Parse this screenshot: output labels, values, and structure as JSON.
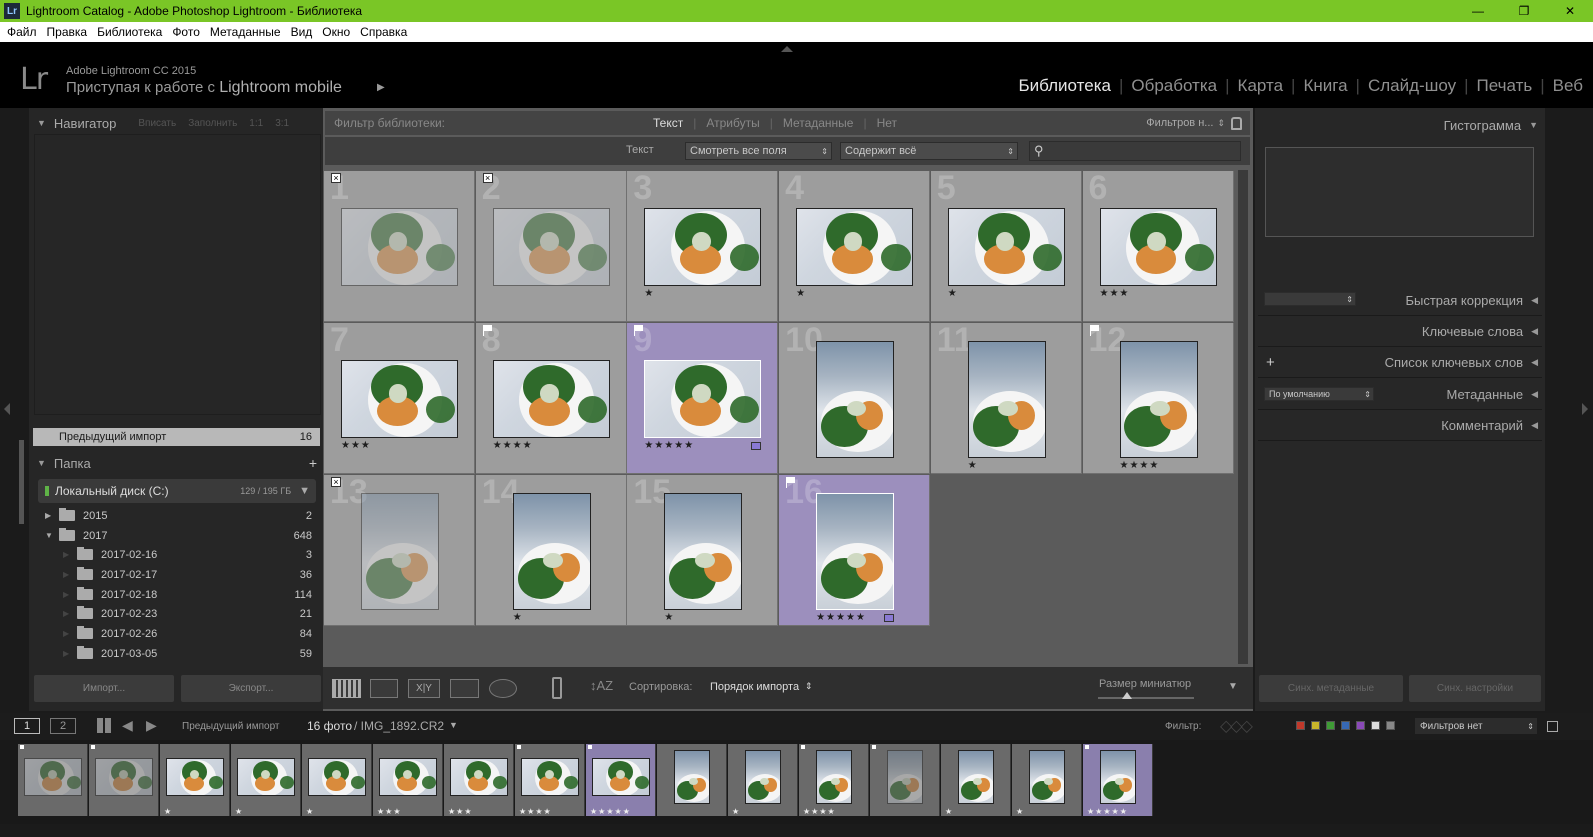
{
  "window": {
    "app_icon": "Lr",
    "title": "Lightroom Catalog - Adobe Photoshop Lightroom - Библиотека",
    "minimize": "—",
    "maximize": "❐",
    "close": "✕"
  },
  "menu": [
    "Файл",
    "Правка",
    "Библиотека",
    "Фото",
    "Метаданные",
    "Вид",
    "Окно",
    "Справка"
  ],
  "identity": {
    "logo": "Lr",
    "product": "Adobe Lightroom CC 2015",
    "mobile_prefix": "Приступая к работе с ",
    "mobile_bold": "Lightroom mobile",
    "play": "▶"
  },
  "modules": [
    "Библиотека",
    "Обработка",
    "Карта",
    "Книга",
    "Слайд-шоу",
    "Печать",
    "Веб"
  ],
  "active_module": "Библиотека",
  "navigator": {
    "title": "Навигатор",
    "zoom_options": [
      "Вписать",
      "Заполнить",
      "1:1",
      "3:1"
    ]
  },
  "catalog": {
    "label": "Предыдущий импорт",
    "count": "16"
  },
  "folders": {
    "title": "Папка",
    "add": "+",
    "disk_label": "Локальный диск (C:)",
    "disk_usage": "129 / 195 ГБ",
    "items": [
      {
        "name": "2015",
        "count": "2",
        "expand": "▶"
      },
      {
        "name": "2017",
        "count": "648",
        "expand": "▼"
      },
      {
        "name": "2017-02-16",
        "count": "3",
        "expand": "▶"
      },
      {
        "name": "2017-02-17",
        "count": "36",
        "expand": "▶"
      },
      {
        "name": "2017-02-18",
        "count": "114",
        "expand": "▶"
      },
      {
        "name": "2017-02-23",
        "count": "21",
        "expand": "▶"
      },
      {
        "name": "2017-02-26",
        "count": "84",
        "expand": "▶"
      },
      {
        "name": "2017-03-05",
        "count": "59",
        "expand": "▶"
      }
    ]
  },
  "left_buttons": {
    "import": "Импорт...",
    "export": "Экспорт..."
  },
  "filter_bar": {
    "label": "Фильтр библиотеки:",
    "tabs": [
      "Текст",
      "Атрибуты",
      "Метаданные",
      "Нет"
    ],
    "presets": "Фильтров н...",
    "text_label": "Текст",
    "field_select": "Смотреть все поля",
    "rule_select": "Содержит всё",
    "search_placeholder": ""
  },
  "grid": [
    {
      "num": "1",
      "orient": "h",
      "stars": "",
      "mark": "reject",
      "dim": true,
      "selected": false,
      "label": false
    },
    {
      "num": "2",
      "orient": "h",
      "stars": "",
      "mark": "reject",
      "dim": true,
      "selected": false,
      "label": false
    },
    {
      "num": "3",
      "orient": "h",
      "stars": "★",
      "mark": "",
      "dim": false,
      "selected": false,
      "label": false
    },
    {
      "num": "4",
      "orient": "h",
      "stars": "★",
      "mark": "",
      "dim": false,
      "selected": false,
      "label": false
    },
    {
      "num": "5",
      "orient": "h",
      "stars": "★",
      "mark": "",
      "dim": false,
      "selected": false,
      "label": false
    },
    {
      "num": "6",
      "orient": "h",
      "stars": "★★★",
      "mark": "",
      "dim": false,
      "selected": false,
      "label": false
    },
    {
      "num": "7",
      "orient": "h",
      "stars": "★★★",
      "mark": "",
      "dim": false,
      "selected": false,
      "label": false
    },
    {
      "num": "8",
      "orient": "h",
      "stars": "★★★★",
      "mark": "flag",
      "dim": false,
      "selected": false,
      "label": false
    },
    {
      "num": "9",
      "orient": "h",
      "stars": "★★★★★",
      "mark": "flag",
      "dim": false,
      "selected": true,
      "label": true
    },
    {
      "num": "10",
      "orient": "v",
      "stars": "",
      "mark": "",
      "dim": false,
      "selected": false,
      "label": false
    },
    {
      "num": "11",
      "orient": "v",
      "stars": "★",
      "mark": "",
      "dim": false,
      "selected": false,
      "label": false
    },
    {
      "num": "12",
      "orient": "v",
      "stars": "★★★★",
      "mark": "flag",
      "dim": false,
      "selected": false,
      "label": false
    },
    {
      "num": "13",
      "orient": "v",
      "stars": "",
      "mark": "reject",
      "dim": true,
      "selected": false,
      "label": false
    },
    {
      "num": "14",
      "orient": "v",
      "stars": "★",
      "mark": "",
      "dim": false,
      "selected": false,
      "label": false
    },
    {
      "num": "15",
      "orient": "v",
      "stars": "★",
      "mark": "",
      "dim": false,
      "selected": false,
      "label": false
    },
    {
      "num": "16",
      "orient": "v",
      "stars": "★★★★★",
      "mark": "flag",
      "dim": false,
      "selected": true,
      "label": true
    }
  ],
  "toolbar": {
    "sort_label": "Сортировка:",
    "sort_value": "Порядок импорта",
    "thumb_size_label": "Размер миниатюр",
    "view_xy": "X|Y",
    "thumbnail_size": 0.3
  },
  "right_panel": {
    "histogram": "Гистограмма",
    "quick_develop": "Быстрая коррекция",
    "keywording": "Ключевые слова",
    "keyword_list": "Список ключевых слов",
    "metadata": "Метаданные",
    "metadata_preset": "По умолчанию",
    "comments": "Комментарий",
    "sync_metadata": "Синх. метаданные",
    "sync_settings": "Синх. настройки"
  },
  "filmstrip_bar": {
    "screen1": "1",
    "screen2": "2",
    "source": "Предыдущий импорт",
    "count": "16 фото",
    "file": "/ IMG_1892.CR2",
    "filter_label": "Фильтр:",
    "filter_value": "Фильтров нет"
  },
  "colors": {
    "titlebar": "#7ac626",
    "selected_cell": "#9c8fbd",
    "label_purple": "#8a79d4",
    "label_swatches": [
      "#c0392b",
      "#c8b52b",
      "#3f9b36",
      "#3768b3",
      "#8a4ab8",
      "#dddddd",
      "#888888"
    ]
  }
}
